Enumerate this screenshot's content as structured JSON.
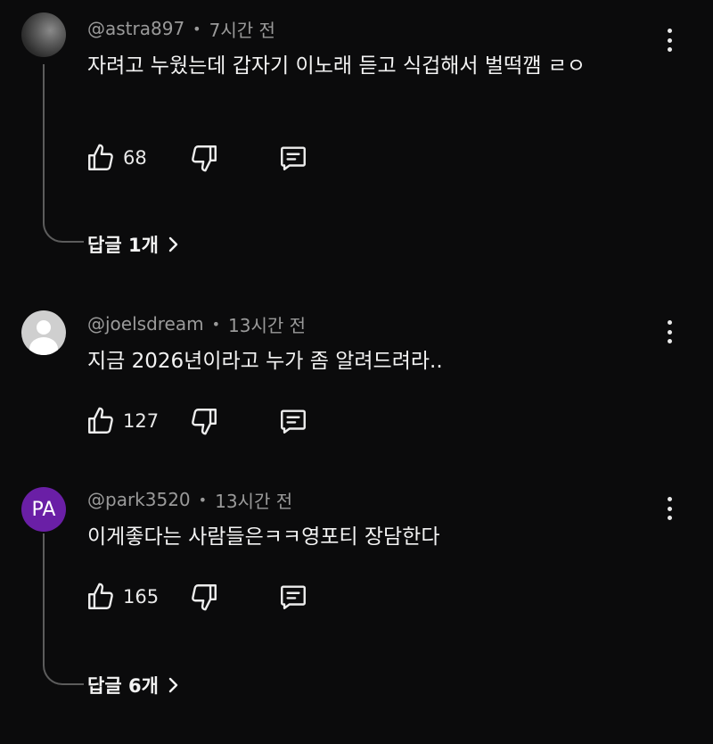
{
  "comments": [
    {
      "author": "@astra897",
      "time": "7시간 전",
      "text": "자려고 누웠는데 갑자기 이노래 듣고 식겁해서 벌떡깸 ㄹㅇ",
      "likes": "68",
      "replies_label": "답글 1개",
      "avatar": "photo-avatar"
    },
    {
      "author": "@joelsdream",
      "time": "13시간 전",
      "text": "지금 2026년이라고 누가 좀 알려드려라..",
      "likes": "127",
      "avatar": "default-user-avatar"
    },
    {
      "author": "@park3520",
      "time": "13시간 전",
      "text": "이게좋다는 사람들은ㅋㅋ영포티 장담한다",
      "likes": "165",
      "replies_label": "답글 6개",
      "avatar_initials": "PA",
      "avatar_color": "#6a1fa6"
    }
  ],
  "separator": "•",
  "icons": {
    "like": "thumbs-up-icon",
    "dislike": "thumbs-down-icon",
    "reply": "comment-icon",
    "more": "kebab-menu-icon",
    "expand": "chevron-right-icon"
  },
  "colors": {
    "background": "#0b0b0c",
    "text": "#f3f3f3",
    "meta": "#9a9a9a"
  }
}
